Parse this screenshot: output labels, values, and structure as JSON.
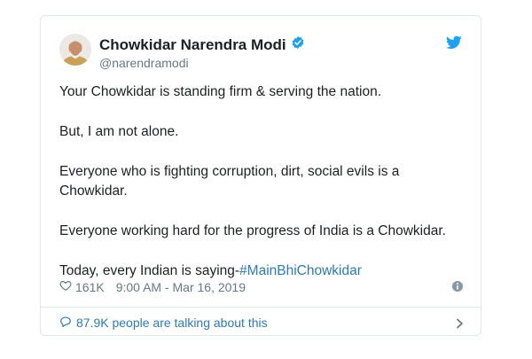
{
  "author": {
    "name": "Chowkidar Narendra Modi",
    "handle": "@narendramodi",
    "verified_color": "#1da1f2"
  },
  "brand": {
    "icon": "twitter-bird-icon",
    "color": "#1da1f2"
  },
  "tweet": {
    "paragraphs": [
      "Your Chowkidar is standing firm & serving the nation.",
      "But, I am not alone.",
      "Everyone who is fighting corruption, dirt, social evils is a Chowkidar.",
      "Everyone working hard for the progress of India is a Chowkidar."
    ],
    "last_line_prefix": "Today, every Indian is saying-",
    "hashtag": "#MainBhiChowkidar",
    "hashtag_color": "#2b7bb9"
  },
  "meta": {
    "likes": "161K",
    "timestamp": "9:00 AM - Mar 16, 2019"
  },
  "footer": {
    "talking": "87.9K people are talking about this"
  }
}
